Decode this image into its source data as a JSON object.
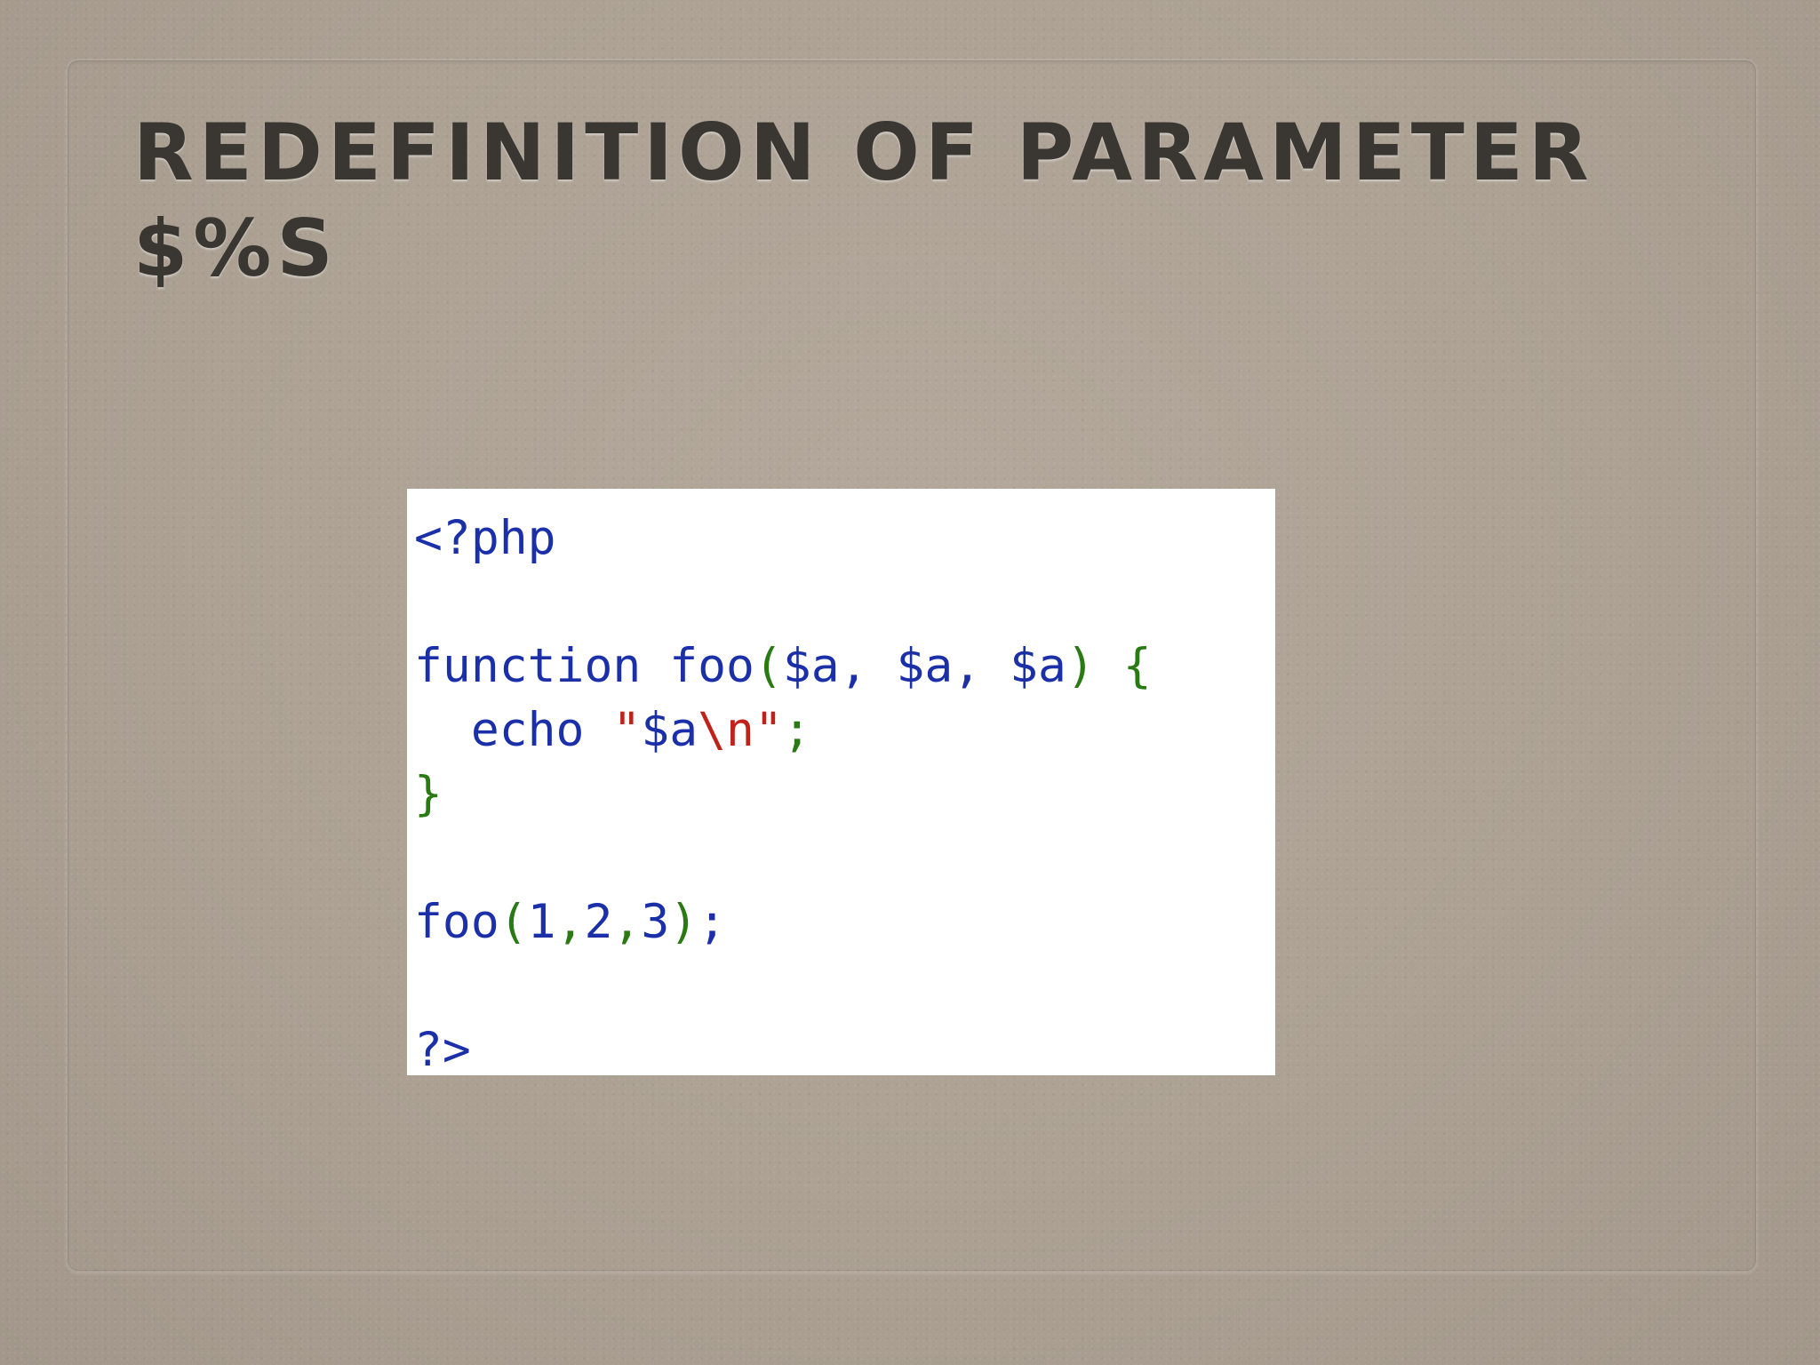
{
  "slide": {
    "title_line1": "Redefinition of parameter",
    "title_line2": "$%s"
  },
  "code": {
    "line1": {
      "open_tag": "<?php"
    },
    "line3": {
      "keyword": "function",
      "name": " foo",
      "paren_open": "(",
      "params": "$a, $a, $a",
      "paren_close": ")",
      "brace_open": " {"
    },
    "line4": {
      "indent": "  ",
      "echo": "echo",
      "space": " ",
      "quote_open": "\"",
      "var": "$a",
      "escape": "\\n",
      "quote_close": "\"",
      "semicolon": ";"
    },
    "line5": {
      "brace_close": "}"
    },
    "line7": {
      "call": "foo",
      "paren_open": "(",
      "arg1": "1",
      "comma1": ",",
      "arg2": "2",
      "comma2": ",",
      "arg3": "3",
      "paren_close": ")",
      "semicolon": ";"
    },
    "line9": {
      "close_tag": "?>"
    }
  },
  "colors": {
    "background": "#aca193",
    "title": "#3a3733",
    "code_default": "#1a2fa8",
    "code_punct": "#2a7a14",
    "code_string": "#c0221a",
    "code_background": "#ffffff"
  }
}
